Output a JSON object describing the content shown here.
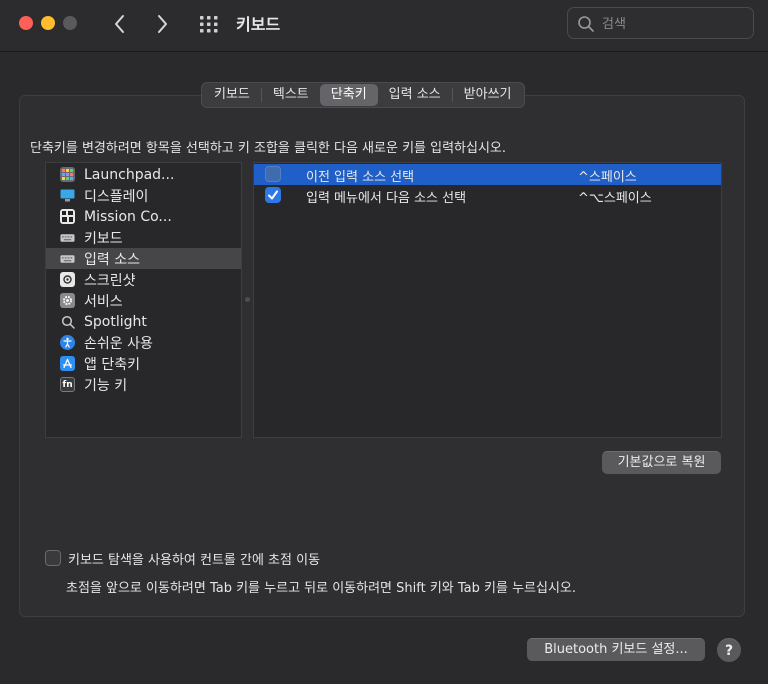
{
  "window": {
    "title": "키보드"
  },
  "search": {
    "placeholder": "검색"
  },
  "tabs": [
    {
      "label": "키보드",
      "active": false
    },
    {
      "label": "텍스트",
      "active": false
    },
    {
      "label": "단축키",
      "active": true
    },
    {
      "label": "입력 소스",
      "active": false
    },
    {
      "label": "받아쓰기",
      "active": false
    }
  ],
  "instruction": "단축키를 변경하려면 항목을 선택하고 키 조합을 클릭한 다음 새로운 키를 입력하십시오.",
  "categories": [
    {
      "label": "Launchpad...",
      "icon": "launchpad-icon",
      "selected": false
    },
    {
      "label": "디스플레이",
      "icon": "display-icon",
      "selected": false
    },
    {
      "label": "Mission Co...",
      "icon": "mission-control-icon",
      "selected": false
    },
    {
      "label": "키보드",
      "icon": "keyboard-icon",
      "selected": false
    },
    {
      "label": "입력 소스",
      "icon": "input-source-icon",
      "selected": true
    },
    {
      "label": "스크린샷",
      "icon": "screenshot-icon",
      "selected": false
    },
    {
      "label": "서비스",
      "icon": "services-gear-icon",
      "selected": false
    },
    {
      "label": "Spotlight",
      "icon": "spotlight-search-icon",
      "selected": false
    },
    {
      "label": "손쉬운 사용",
      "icon": "accessibility-icon",
      "selected": false
    },
    {
      "label": "앱 단축키",
      "icon": "app-store-icon",
      "selected": false
    },
    {
      "label": "기능 키",
      "icon": "fn-key-icon",
      "selected": false
    }
  ],
  "shortcuts": [
    {
      "label": "이전 입력 소스 선택",
      "key": "^스페이스",
      "checked": false,
      "selected": true
    },
    {
      "label": "입력 메뉴에서 다음 소스 선택",
      "key": "^⌥스페이스",
      "checked": true,
      "selected": false
    }
  ],
  "restore_button": "기본값으로 복원",
  "keyboard_navigation": {
    "label": "키보드 탐색을 사용하여 컨트롤 간에 초점 이동",
    "checked": false,
    "help": "초점을 앞으로 이동하려면 Tab 키를 누르고 뒤로 이동하려면 Shift 키와 Tab 키를 누르십시오."
  },
  "bluetooth_button": "Bluetooth 키보드 설정...",
  "help_button": "?",
  "colors": {
    "selection_blue": "#1f5fc7",
    "checkbox_blue": "#2d78e6",
    "close": "#fe5f57",
    "minimize": "#febc2e"
  }
}
